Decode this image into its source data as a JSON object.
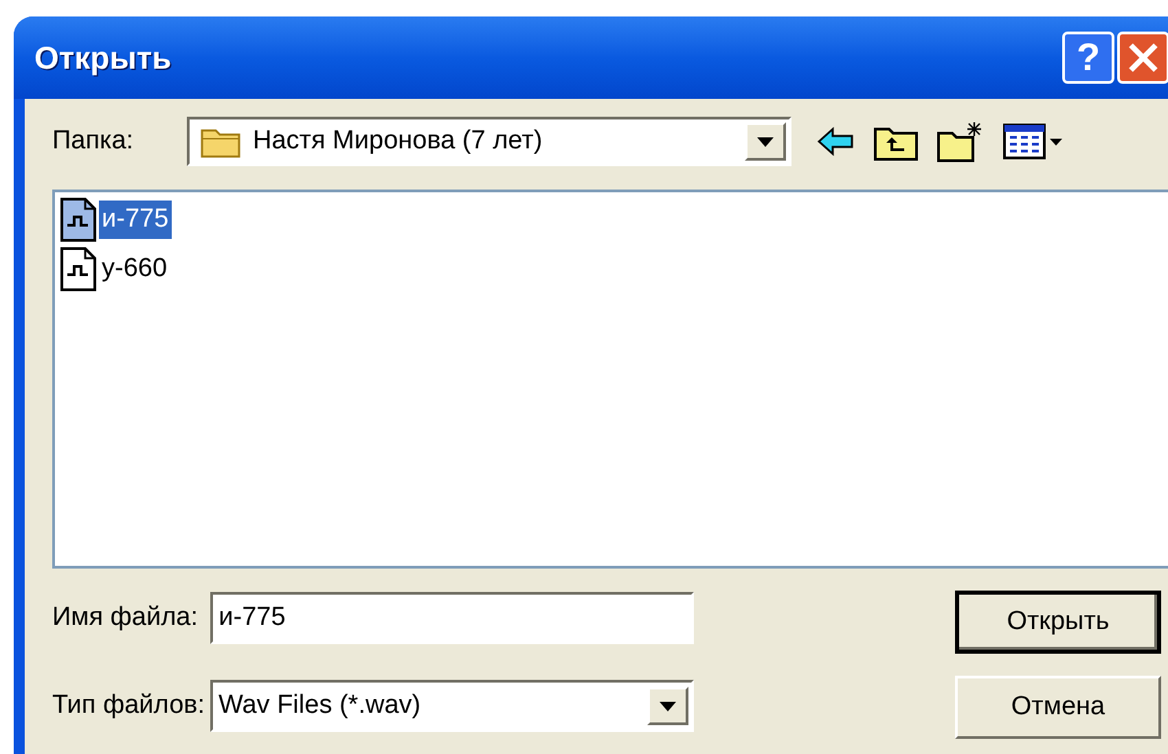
{
  "window": {
    "title": "Открыть"
  },
  "title_buttons": [
    {
      "kind": "help",
      "label": "?"
    },
    {
      "kind": "close"
    }
  ],
  "folder": {
    "label": "Папка:",
    "value": "Настя Миронова (7 лет)"
  },
  "toolbar": [
    {
      "kind": "back"
    },
    {
      "kind": "up"
    },
    {
      "kind": "new-folder"
    },
    {
      "kind": "view"
    }
  ],
  "files": [
    {
      "name": "и-775",
      "selected": true
    },
    {
      "name": "у-660",
      "selected": false
    }
  ],
  "file_name": {
    "label": "Имя файла:",
    "value": "и-775"
  },
  "file_type": {
    "label": "Тип файлов:",
    "value": "Wav Files (*.wav)"
  },
  "buttons": [
    {
      "label": "Открыть",
      "default": true
    },
    {
      "label": "Отмена",
      "default": false
    }
  ]
}
